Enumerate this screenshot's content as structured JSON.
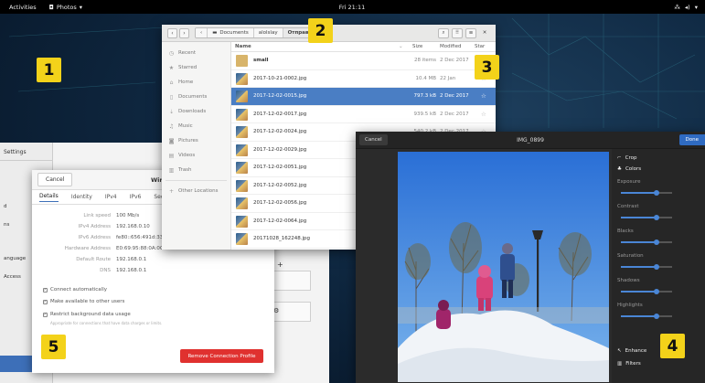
{
  "topbar": {
    "activities": "Activities",
    "app_name": "Photos",
    "clock": "Fri 21:11"
  },
  "markers": [
    "1",
    "2",
    "3",
    "4",
    "5"
  ],
  "settings": {
    "sidebar_title": "Settings",
    "sidebar_items": [
      "d",
      "ns",
      "anguage",
      "Access"
    ],
    "wifi_plus": "+"
  },
  "wired": {
    "cancel": "Cancel",
    "title": "Wired",
    "tabs": [
      "Details",
      "Identity",
      "IPv4",
      "IPv6",
      "Secu"
    ],
    "details": [
      {
        "k": "Link speed",
        "v": "100 Mb/s"
      },
      {
        "k": "IPv4 Address",
        "v": "192.168.0.10"
      },
      {
        "k": "IPv6 Address",
        "v": "fe80::656:491d:333:fe89"
      },
      {
        "k": "Hardware Address",
        "v": "E0:69:95:88:0A:0C"
      },
      {
        "k": "Default Route",
        "v": "192.168.0.1"
      },
      {
        "k": "DNS",
        "v": "192.168.0.1"
      }
    ],
    "checks": [
      {
        "label": "Connect automatically",
        "checked": true
      },
      {
        "label": "Make available to other users",
        "checked": true
      },
      {
        "label": "Restrict background data usage",
        "checked": true
      }
    ],
    "restrict_sub": "Appropriate for connections that have data charges or limits.",
    "remove_button": "Remove Connection Profile"
  },
  "files": {
    "breadcrumbs": [
      "Documents",
      "alolslay",
      "Отправка"
    ],
    "sidebar": [
      "Recent",
      "Starred",
      "Home",
      "Documents",
      "Downloads",
      "Music",
      "Pictures",
      "Videos",
      "Trash",
      "Other Locations"
    ],
    "columns": {
      "name": "Name",
      "size": "Size",
      "modified": "Modified",
      "star": "Star"
    },
    "rows": [
      {
        "name": "small",
        "size": "28 items",
        "modified": "2 Dec 2017",
        "folder": true,
        "selected": false
      },
      {
        "name": "2017-10-21-0002.jpg",
        "size": "10.4 MB",
        "modified": "22 Jan",
        "folder": false,
        "selected": false
      },
      {
        "name": "2017-12-02-0015.jpg",
        "size": "797.3 kB",
        "modified": "2 Dec 2017",
        "folder": false,
        "selected": true
      },
      {
        "name": "2017-12-02-0017.jpg",
        "size": "939.5 kB",
        "modified": "2 Dec 2017",
        "folder": false,
        "selected": false
      },
      {
        "name": "2017-12-02-0024.jpg",
        "size": "540.2 kB",
        "modified": "2 Dec 2017",
        "folder": false,
        "selected": false
      },
      {
        "name": "2017-12-02-0029.jpg",
        "size": "",
        "modified": "",
        "folder": false,
        "selected": false
      },
      {
        "name": "2017-12-02-0051.jpg",
        "size": "",
        "modified": "",
        "folder": false,
        "selected": false
      },
      {
        "name": "2017-12-02-0052.jpg",
        "size": "",
        "modified": "",
        "folder": false,
        "selected": false
      },
      {
        "name": "2017-12-02-0056.jpg",
        "size": "",
        "modified": "",
        "folder": false,
        "selected": false
      },
      {
        "name": "2017-12-02-0064.jpg",
        "size": "",
        "modified": "",
        "folder": false,
        "selected": false
      },
      {
        "name": "20171028_162248.jpg",
        "size": "",
        "modified": "",
        "folder": false,
        "selected": false
      }
    ]
  },
  "editor": {
    "cancel": "Cancel",
    "title": "IMG_0899",
    "done": "Done",
    "tools": [
      "Crop",
      "Colors"
    ],
    "adjustments": [
      {
        "label": "Exposure",
        "value": 0.7
      },
      {
        "label": "Contrast",
        "value": 0.7
      },
      {
        "label": "Blacks",
        "value": 0.7
      },
      {
        "label": "Saturation",
        "value": 0.7
      },
      {
        "label": "Shadows",
        "value": 0.7
      },
      {
        "label": "Highlights",
        "value": 0.7
      }
    ],
    "bottom_tools": [
      "Enhance",
      "Filters"
    ]
  },
  "colors": {
    "accent": "#3d6fb8",
    "marker": "#f3d21a",
    "remove": "#e0312f"
  }
}
